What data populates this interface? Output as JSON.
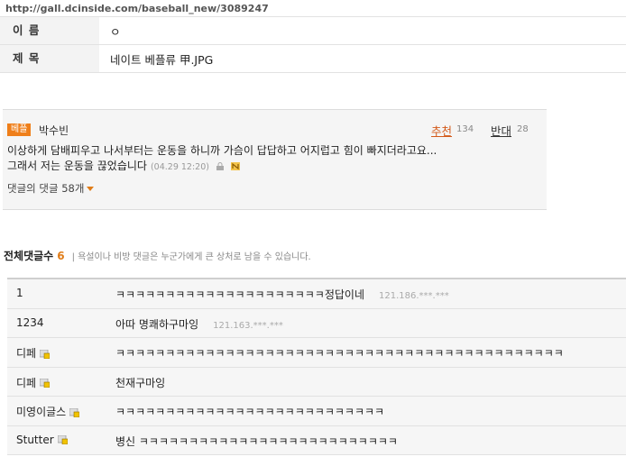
{
  "url": "http://gall.dcinside.com/baseball_new/3089247",
  "post": {
    "name_label": "이 름",
    "name_value": "ㅇ",
    "title_label": "제 목",
    "title_value": "네이트 베플류 甲.JPG"
  },
  "best_comment": {
    "badge": "베플",
    "author": "박수빈",
    "recommend_label": "추천",
    "recommend_count": "134",
    "oppose_label": "반대",
    "oppose_count": "28",
    "line1": "이상하게 담배피우고 나서부터는 운동을 하니까 가슴이 답답하고 어지럽고 힘이 빠지더라고요...",
    "line2": "그래서 저는 운동을 끊었습니다",
    "date": "(04.29 12:20)",
    "reply_toggle": "댓글의 댓글 58개"
  },
  "comments_header": {
    "label": "전체댓글수",
    "count": "6",
    "notice": "| 욕설이나 비방 댓글은 누군가에게 큰 상처로 남을 수 있습니다."
  },
  "comments": [
    {
      "name": "1",
      "text": "ㅋㅋㅋㅋㅋㅋㅋㅋㅋㅋㅋㅋㅋㅋㅋㅋㅋㅋㅋㅋㅋ정답이네",
      "ip": "121.186.***.***"
    },
    {
      "name": "1234",
      "text": "아따 명쾌하구마잉",
      "ip": "121.163.***.***"
    },
    {
      "name": "디페",
      "text": "ㅋㅋㅋㅋㅋㅋㅋㅋㅋㅋㅋㅋㅋㅋㅋㅋㅋㅋㅋㅋㅋㅋㅋㅋㅋㅋㅋㅋㅋㅋㅋㅋㅋㅋㅋㅋㅋㅋㅋㅋㅋㅋㅋㅋㅋ",
      "ip": ""
    },
    {
      "name": "디페",
      "text": "천재구마잉",
      "ip": ""
    },
    {
      "name": "미영이글스",
      "text": "ㅋㅋㅋㅋㅋㅋㅋㅋㅋㅋㅋㅋㅋㅋㅋㅋㅋㅋㅋㅋㅋㅋㅋㅋㅋㅋㅋ",
      "ip": ""
    },
    {
      "name": "Stutter",
      "text": "병신 ㅋㅋㅋㅋㅋㅋㅋㅋㅋㅋㅋㅋㅋㅋㅋㅋㅋㅋㅋㅋㅋㅋㅋㅋㅋㅋ",
      "ip": ""
    }
  ],
  "colors": {
    "accent": "#e07c18",
    "badge": "#ef7f1a"
  }
}
